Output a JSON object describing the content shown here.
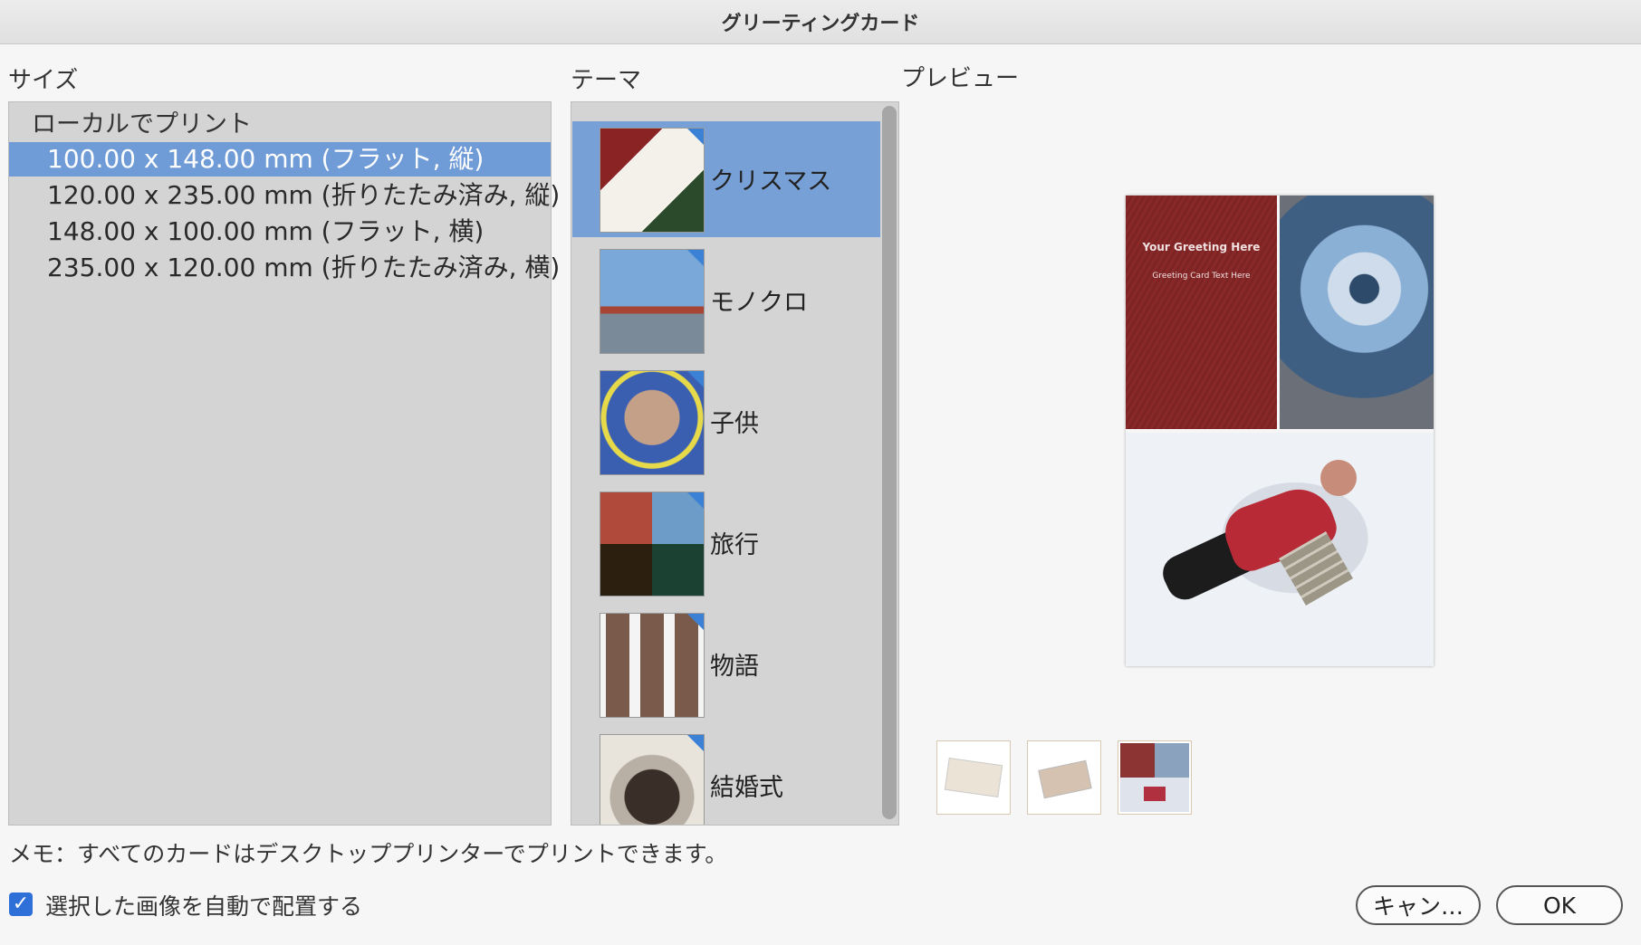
{
  "window": {
    "title": "グリーティングカード"
  },
  "labels": {
    "size": "サイズ",
    "theme": "テーマ",
    "preview": "プレビュー"
  },
  "size_list": {
    "group": "ローカルでプリント",
    "items": [
      {
        "label": "100.00 x 148.00 mm (フラット, 縦)",
        "selected": true
      },
      {
        "label": "120.00 x 235.00 mm (折りたたみ済み, 縦)",
        "selected": false
      },
      {
        "label": "148.00 x 100.00 mm (フラット, 横)",
        "selected": false
      },
      {
        "label": "235.00 x 120.00 mm (折りたたみ済み, 横)",
        "selected": false
      }
    ]
  },
  "themes": [
    {
      "label": "クリスマス",
      "selected": true,
      "thumb_color": "#8a2424"
    },
    {
      "label": "モノクロ",
      "selected": false,
      "thumb_color": "#a24a3a"
    },
    {
      "label": "子供",
      "selected": false,
      "thumb_color": "#3a5fb0"
    },
    {
      "label": "旅行",
      "selected": false,
      "thumb_color": "#6d8c70"
    },
    {
      "label": "物語",
      "selected": false,
      "thumb_color": "#f2f2f2"
    },
    {
      "label": "結婚式",
      "selected": false,
      "thumb_color": "#7a6e60"
    }
  ],
  "preview": {
    "greeting_title": "Your Greeting Here",
    "greeting_text": "Greeting Card Text Here"
  },
  "memo": "メモ：すべてのカードはデスクトッププリンターでプリントできます。",
  "auto_place": {
    "label": "選択した画像を自動で配置する",
    "checked": true
  },
  "buttons": {
    "cancel": "キャン…",
    "ok": "OK"
  },
  "colors": {
    "selection": "#6f9bd6",
    "accent": "#2f6fd8"
  }
}
